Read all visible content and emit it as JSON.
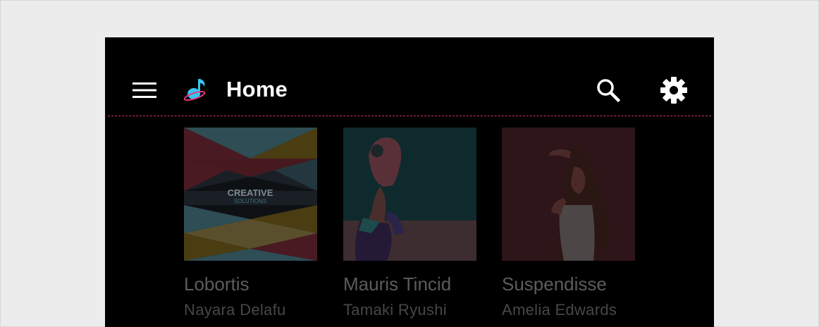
{
  "header": {
    "title": "Home",
    "menu_icon": "hamburger-menu-icon",
    "logo_icon": "music-note-planet-logo",
    "search_icon": "search-icon",
    "settings_icon": "gear-icon"
  },
  "albums": [
    {
      "title": "Lobortis",
      "artist": "Nayara Delafu",
      "art_text_top": "CREATIVE",
      "art_text_bottom": "SOLUTIONS"
    },
    {
      "title": "Mauris Tincid",
      "artist": "Tamaki Ryushi"
    },
    {
      "title": "Suspendisse",
      "artist": "Amelia Edwards"
    }
  ],
  "colors": {
    "background": "#000000",
    "accent": "#d0317a",
    "logo_primary": "#36c5f0",
    "logo_ring": "#e8387f"
  }
}
